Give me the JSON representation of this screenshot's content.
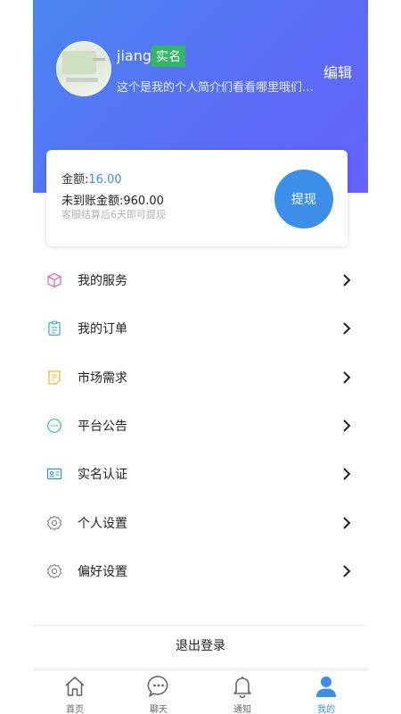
{
  "profile": {
    "username": "jiang",
    "verified_badge": "实名",
    "edit_label": "编辑",
    "bio": "这个是我的个人简介们看看哪里哦们聊..."
  },
  "balance": {
    "amount_label": "金额:",
    "amount_value": "16.00",
    "pending_label": "未到账金额:960.00",
    "hint": "客服结算后6天即可提现",
    "withdraw_label": "提现"
  },
  "menu": [
    {
      "label": "我的服务",
      "icon": "cube-icon"
    },
    {
      "label": "我的订单",
      "icon": "clipboard-icon"
    },
    {
      "label": "市场需求",
      "icon": "document-list-icon"
    },
    {
      "label": "平台公告",
      "icon": "chat-bubble-icon"
    },
    {
      "label": "实名认证",
      "icon": "id-card-icon"
    },
    {
      "label": "个人设置",
      "icon": "gear-icon"
    },
    {
      "label": "偏好设置",
      "icon": "gear-icon"
    }
  ],
  "logout_label": "退出登录",
  "tabs": [
    {
      "label": "首页",
      "icon": "home-icon",
      "active": false
    },
    {
      "label": "聊天",
      "icon": "chat-icon",
      "active": false
    },
    {
      "label": "通知",
      "icon": "bell-icon",
      "active": false
    },
    {
      "label": "我的",
      "icon": "person-icon",
      "active": true
    }
  ],
  "colors": {
    "header_gradient_start": "#4a86f0",
    "header_gradient_end": "#6562fb",
    "badge_green": "#34b567",
    "accent_blue": "#3b8fe8"
  }
}
